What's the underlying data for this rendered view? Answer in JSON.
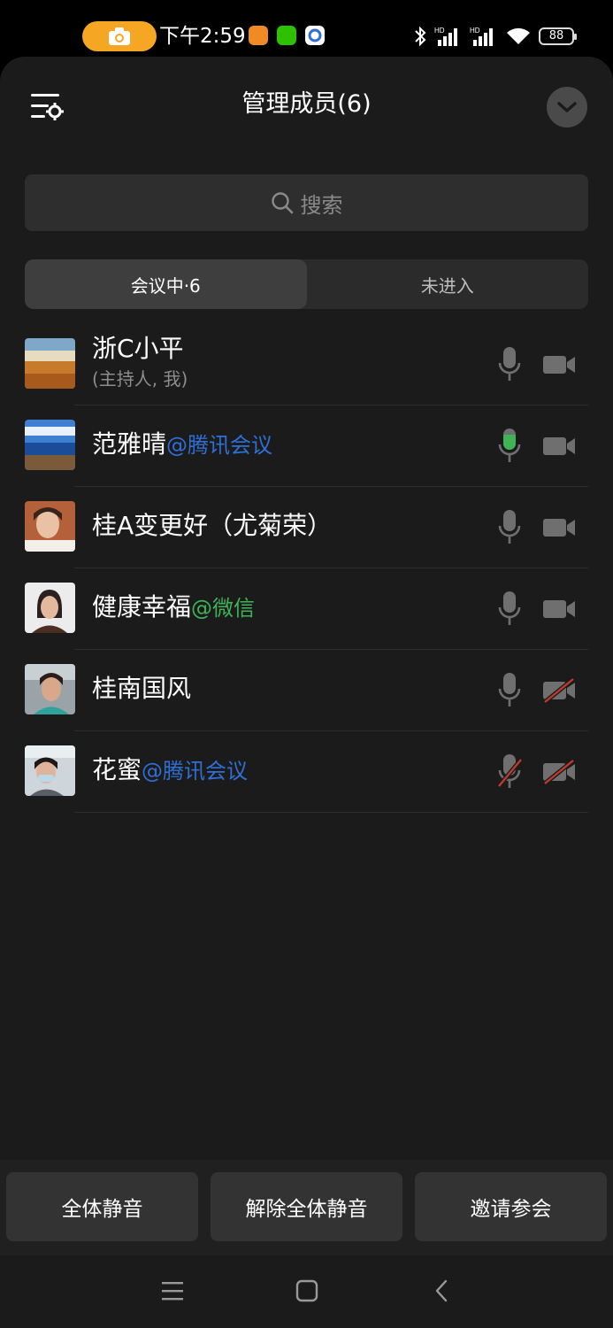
{
  "status_bar": {
    "time": "下午2:59",
    "battery": "88",
    "icons": [
      "camera-icon",
      "app-badge-icon",
      "wechat-icon",
      "tencent-meeting-icon",
      "bluetooth-icon",
      "signal-hd-1-icon",
      "signal-hd-2-icon",
      "wifi-icon",
      "battery-icon"
    ]
  },
  "header": {
    "title": "管理成员(6)",
    "menu_icon": "member-settings-icon",
    "collapse_icon": "chevron-down-icon"
  },
  "search": {
    "placeholder": "搜索",
    "icon": "search-icon"
  },
  "tabs": [
    {
      "label": "会议中·6",
      "active": true
    },
    {
      "label": "未进入",
      "active": false
    }
  ],
  "members": [
    {
      "name": "浙C小平",
      "suffix": "",
      "suffix_color": "",
      "subtitle": "(主持人, 我)",
      "mic": "off",
      "camera": "off"
    },
    {
      "name": "范雅晴",
      "suffix": "@腾讯会议",
      "suffix_color": "#2f6fd6",
      "subtitle": "",
      "mic": "speaking",
      "camera": "off"
    },
    {
      "name": "桂A变更好（尤菊荣）",
      "suffix": "",
      "suffix_color": "",
      "subtitle": "",
      "mic": "off",
      "camera": "off"
    },
    {
      "name": "健康幸福",
      "suffix": "@微信",
      "suffix_color": "#3fb457",
      "subtitle": "",
      "mic": "off",
      "camera": "off"
    },
    {
      "name": "桂南国风",
      "suffix": "",
      "suffix_color": "",
      "subtitle": "",
      "mic": "off",
      "camera": "disabled"
    },
    {
      "name": "花蜜",
      "suffix": "@腾讯会议",
      "suffix_color": "#2f6fd6",
      "subtitle": "",
      "mic": "disabled",
      "camera": "disabled"
    }
  ],
  "actions": {
    "mute_all": "全体静音",
    "unmute_all": "解除全体静音",
    "invite": "邀请参会"
  },
  "nav": [
    "menu-icon",
    "home-icon",
    "back-icon"
  ],
  "colors": {
    "sheet_bg": "#1b1b1b",
    "accent_orange": "#f5a623",
    "mic_active": "#3fb457",
    "disabled_slash": "#c0392b",
    "tencent_blue": "#2f6fd6",
    "wechat_green": "#3fb457"
  }
}
